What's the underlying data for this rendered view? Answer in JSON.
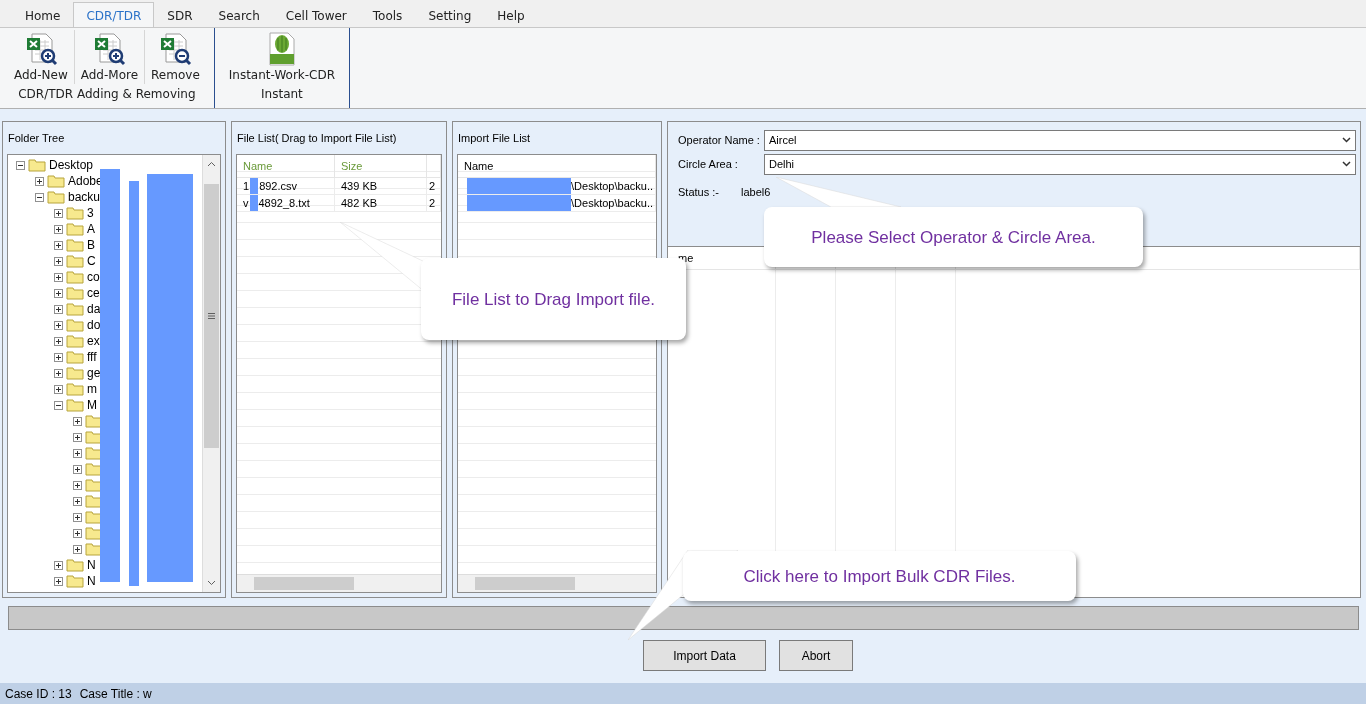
{
  "menu_tabs": [
    {
      "label": "Home",
      "selected": false
    },
    {
      "label": "CDR/TDR",
      "selected": true
    },
    {
      "label": "SDR",
      "selected": false
    },
    {
      "label": "Search",
      "selected": false
    },
    {
      "label": "Cell Tower",
      "selected": false
    },
    {
      "label": "Tools",
      "selected": false
    },
    {
      "label": "Setting",
      "selected": false
    },
    {
      "label": "Help",
      "selected": false
    }
  ],
  "ribbon_groups": [
    {
      "caption": "CDR/TDR Adding & Removing",
      "buttons": [
        {
          "label": "Add-New",
          "kind": "add"
        },
        {
          "label": "Add-More",
          "kind": "add"
        },
        {
          "label": "Remove",
          "kind": "remove"
        }
      ]
    },
    {
      "caption": "Instant",
      "buttons": [
        {
          "label": "Instant-Work-CDR",
          "kind": "cdr"
        }
      ]
    }
  ],
  "folder_tree": {
    "title": "Folder Tree",
    "items": [
      {
        "label": "Desktop",
        "expanded": true,
        "children": [
          {
            "label": "Adobe",
            "expanded": false
          },
          {
            "label": "backu",
            "expanded": true,
            "children": [
              {
                "label": "3",
                "expanded": false
              },
              {
                "label": "A",
                "expanded": false
              },
              {
                "label": "B",
                "expanded": false
              },
              {
                "label": "C",
                "expanded": false
              },
              {
                "label": "co",
                "expanded": false
              },
              {
                "label": "ce",
                "expanded": false
              },
              {
                "label": "da",
                "expanded": false
              },
              {
                "label": "do",
                "expanded": false
              },
              {
                "label": "ex",
                "expanded": false
              },
              {
                "label": "fff",
                "expanded": false
              },
              {
                "label": "ge",
                "expanded": false
              },
              {
                "label": "m",
                "expanded": false
              },
              {
                "label": "M",
                "expanded": true,
                "children": [
                  {
                    "expanded": false
                  },
                  {
                    "expanded": false
                  },
                  {
                    "expanded": false
                  },
                  {
                    "expanded": false
                  },
                  {
                    "expanded": false
                  },
                  {
                    "expanded": false
                  },
                  {
                    "expanded": false
                  },
                  {
                    "expanded": false
                  },
                  {
                    "expanded": false
                  }
                ]
              },
              {
                "label": "N",
                "expanded": false
              },
              {
                "label": "N",
                "expanded": false
              }
            ]
          }
        ]
      }
    ]
  },
  "file_list": {
    "title": "File List( Drag to Import File List)",
    "columns": [
      "Name",
      "Size"
    ],
    "rows": [
      {
        "prefix": "1",
        "name": "892.csv",
        "size": "439 KB",
        "column_3": "2"
      },
      {
        "prefix": "v",
        "name": "4892_8.txt",
        "size": "482 KB",
        "column_3": "2"
      }
    ]
  },
  "import_file_list": {
    "title": "Import File List",
    "columns": [
      "Name"
    ],
    "rows": [
      {
        "path": "\\Desktop\\backu.."
      },
      {
        "path": "\\Desktop\\backu.."
      }
    ]
  },
  "operator": {
    "label": "Operator Name :",
    "value": "Aircel"
  },
  "circle": {
    "label": "Circle Area :",
    "value": "Delhi"
  },
  "status": {
    "label": "Status :-",
    "value": "label6"
  },
  "result_grid": {
    "column_1": "me"
  },
  "progress": {
    "level": 0
  },
  "buttons": [
    "Import Data",
    "Abort"
  ],
  "callouts": [
    "File List to Drag Import file.",
    "Please Select Operator & Circle Area.",
    "Click here to Import Bulk CDR Files."
  ],
  "status_bar": {
    "case_id": "Case ID : 13",
    "case_title": "Case Title : w"
  }
}
